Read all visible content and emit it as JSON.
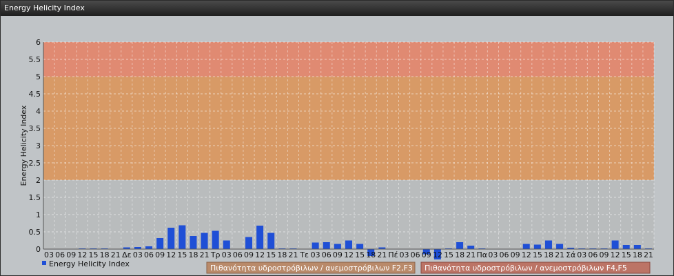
{
  "window": {
    "title": "Energy Helicity Index"
  },
  "colors": {
    "bar": "#1f4fd6",
    "band_low": "#b9bcbd",
    "band_mid": "#d89a66",
    "band_high": "#e08a72",
    "legend_mid": "#b98a6a",
    "legend_high": "#bc7466"
  },
  "chart_data": {
    "type": "bar",
    "ylabel": "Energy Helicity Index",
    "ylim": [
      0,
      6
    ],
    "yticks": [
      0,
      0.5,
      1,
      1.5,
      2,
      2.5,
      3,
      3.5,
      4,
      4.5,
      5,
      5.5,
      6
    ],
    "grid": true,
    "legend_position": "bottom-left",
    "bands": [
      {
        "from": 0,
        "to": 2,
        "color": "#b9bcbd",
        "label": ""
      },
      {
        "from": 2,
        "to": 5,
        "color": "#d89a66",
        "label": "Πιθανότητα υδροστρόβιλων / ανεμοστρόβιλων F2,F3"
      },
      {
        "from": 5,
        "to": 6,
        "color": "#e08a72",
        "label": "Πιθανότητα υδροστρόβιλων / ανεμοστρόβιλων F4,F5"
      }
    ],
    "categories": [
      "03",
      "06",
      "09",
      "12",
      "15",
      "18",
      "21",
      "Δε",
      "03",
      "06",
      "09",
      "12",
      "15",
      "18",
      "21",
      "Τρ",
      "03",
      "06",
      "09",
      "12",
      "15",
      "18",
      "21",
      "Τε",
      "03",
      "06",
      "09",
      "12",
      "15",
      "18",
      "21",
      "Πέ",
      "03",
      "06",
      "09",
      "12",
      "15",
      "18",
      "21",
      "Πα",
      "03",
      "06",
      "09",
      "12",
      "15",
      "18",
      "21",
      "Σά",
      "03",
      "06",
      "09",
      "12",
      "15",
      "18",
      "21"
    ],
    "series": [
      {
        "name": "Energy Helicity Index",
        "values": [
          0.01,
          0.01,
          0.01,
          0.02,
          0.02,
          0.02,
          0.01,
          0.05,
          0.06,
          0.08,
          0.32,
          0.62,
          0.69,
          0.38,
          0.47,
          0.53,
          0.25,
          0.01,
          0.35,
          0.68,
          0.47,
          0.02,
          0.02,
          0.01,
          0.19,
          0.2,
          0.15,
          0.25,
          0.15,
          -0.2,
          0.05,
          0.01,
          0.01,
          0.01,
          -0.15,
          -0.3,
          0.02,
          0.2,
          0.1,
          0.02,
          0.01,
          0.01,
          0.01,
          0.15,
          0.13,
          0.25,
          0.15,
          0.04,
          0.02,
          0.02,
          0.02,
          0.25,
          0.12,
          0.12,
          0.02
        ]
      }
    ]
  }
}
